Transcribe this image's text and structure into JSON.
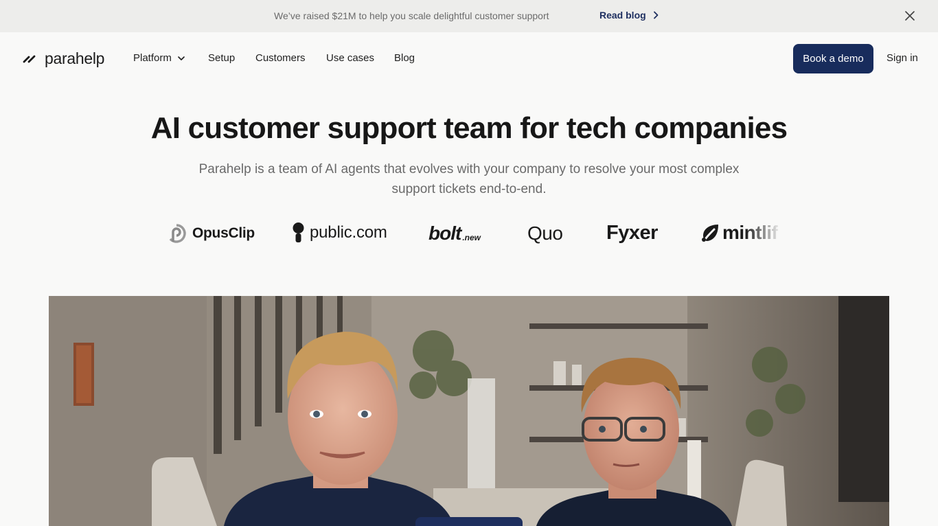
{
  "announcement": {
    "text": "We’ve raised $21M to help you scale delightful customer support",
    "link_label": "Read blog"
  },
  "nav": {
    "brand": "parahelp",
    "items": [
      {
        "label": "Platform",
        "has_dropdown": true
      },
      {
        "label": "Setup"
      },
      {
        "label": "Customers"
      },
      {
        "label": "Use cases"
      },
      {
        "label": "Blog"
      }
    ],
    "cta_label": "Book a demo",
    "signin_label": "Sign in"
  },
  "hero": {
    "title": "AI customer support team for tech companies",
    "subtitle_line1": "Parahelp is a team of AI agents that evolves with your company to resolve your most complex",
    "subtitle_line2": "support tickets end-to-end."
  },
  "customer_logos": [
    {
      "name": "OpusClip"
    },
    {
      "name": "public.com"
    },
    {
      "name": "bolt",
      "suffix": ".new"
    },
    {
      "name": "Quo"
    },
    {
      "name": "Fyxer"
    },
    {
      "name": "mintlify",
      "visible": "mintlif"
    }
  ],
  "colors": {
    "primary": "#182c5c",
    "banner_bg": "#ededeb",
    "page_bg": "#f9f9f8"
  },
  "icons": {
    "logo": "double-slash-icon",
    "link_arrow": "chevron-right-icon",
    "close": "close-icon",
    "dropdown": "chevron-down-icon"
  }
}
